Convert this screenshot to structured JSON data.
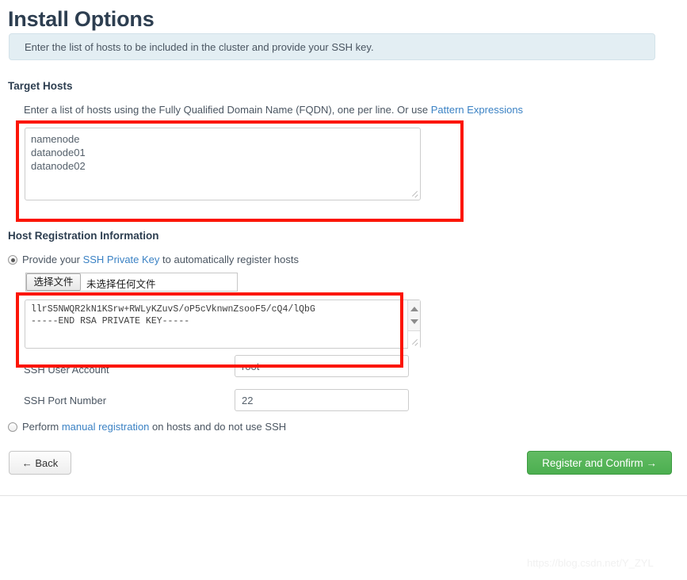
{
  "page": {
    "title": "Install Options",
    "info_message": "Enter the list of hosts to be included in the cluster and provide your SSH key.",
    "watermark": "https://blog.csdn.net/Y_ZYL"
  },
  "target_hosts": {
    "heading": "Target Hosts",
    "helper_prefix": "Enter a list of hosts using the Fully Qualified Domain Name (FQDN), one per line. Or use ",
    "helper_link": "Pattern Expressions",
    "hosts_value": "namenode\ndatanode01\ndatanode02"
  },
  "host_registration": {
    "heading": "Host Registration Information",
    "ssh_option": {
      "prefix": "Provide your ",
      "link": "SSH Private Key",
      "suffix": " to automatically register hosts",
      "selected": true
    },
    "file_input": {
      "button_label": "选择文件",
      "status_label": "未选择任何文件"
    },
    "private_key_value": "llrS5NWQR2kN1KSrw+RWLyKZuvS/oP5cVknwnZsooF5/cQ4/lQbG\n-----END RSA PRIVATE KEY-----",
    "ssh_user_label": "SSH User Account",
    "ssh_user_value": "root",
    "ssh_port_label": "SSH Port Number",
    "ssh_port_value": "22",
    "manual_option": {
      "prefix": "Perform ",
      "link": "manual registration",
      "suffix": " on hosts and do not use SSH",
      "selected": false
    }
  },
  "footer": {
    "back_label": "← Back",
    "confirm_label": "Register and Confirm →"
  },
  "colors": {
    "accent_link": "#3b82c4",
    "confirm_green": "#4caf50",
    "annotation_red": "#fc1505",
    "info_bg": "#e3eef3"
  }
}
